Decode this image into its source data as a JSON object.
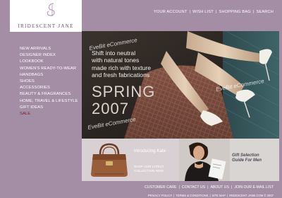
{
  "brand": {
    "name": "IRIDESCENT JANE"
  },
  "top_nav": [
    "YOUR ACCOUNT",
    "WISH LIST",
    "SHOPPING BAG",
    "SEARCH"
  ],
  "side_nav": [
    "NEW ARRIVALS",
    "DESIGNER INDEX",
    "LOOKBOOK",
    "WOMEN'S READY-TO-WEAR",
    "HANDBAGS",
    "SHOES",
    "ACCESSORIES",
    "BEAUTY & FRAGRANCES",
    "HOME, TRAVEL & LIFESTYLE",
    "GIFT IDEAS",
    "SALE"
  ],
  "hero": {
    "line1": "Shift into neutral",
    "line2": "with natural tones",
    "line3": "made rich with texture",
    "line4": "and fresh fabrications",
    "season": "SPRING",
    "year": "2007",
    "watermark": "EveBit eCommerce"
  },
  "promo_kate": {
    "title": "Introducing Kate",
    "cta_line1": "SHOP OUR LATEST",
    "cta_line2": "COLLECTION NOW"
  },
  "promo_men": {
    "title_line1": "Gift Selection",
    "title_line2": "Guide For Men"
  },
  "footer_nav": [
    "CUSTOMER CARE",
    "CONTACT US",
    "ABOUT US",
    "JOIN OUR E-MAIL LIST"
  ],
  "legal_nav": [
    "PRIVACY POLICY",
    "TERMS & CONDITIONS",
    "SITE MAP",
    "IRIDESCENT JANE.COM © 2007"
  ],
  "colors": {
    "background": "#a48ea6",
    "sale": "#7a1f1f",
    "logo_text": "#6e5470"
  }
}
